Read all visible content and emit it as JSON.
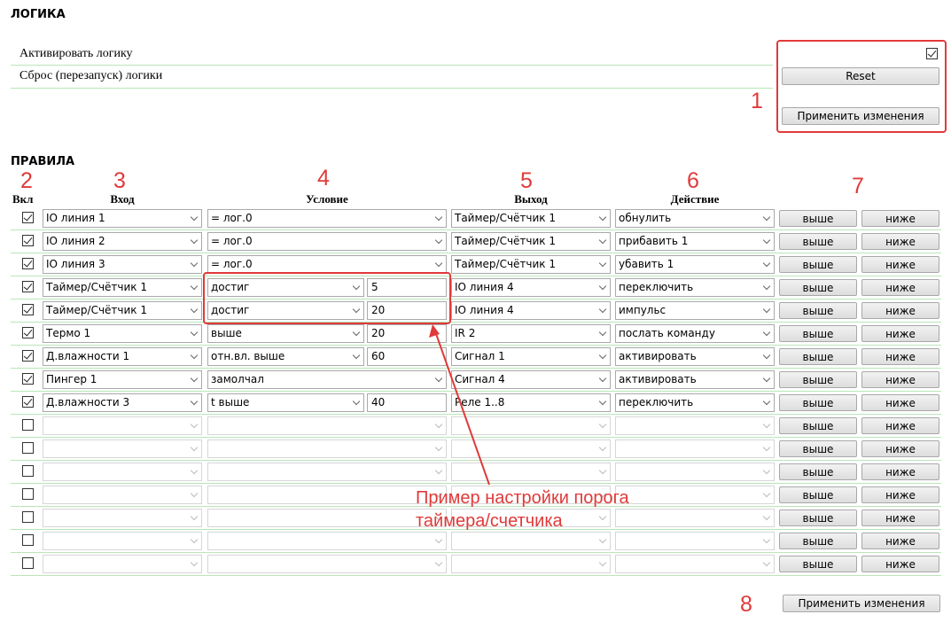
{
  "logic": {
    "title": "ЛОГИКА",
    "activate_label": "Активировать логику",
    "activate_checked": true,
    "reset_label": "Сброс (перезапуск) логики",
    "reset_button": "Reset",
    "apply_button": "Применить изменения"
  },
  "rules": {
    "title": "ПРАВИЛА",
    "headers": {
      "enabled": "Вкл",
      "input": "Вход",
      "condition": "Условие",
      "output": "Выход",
      "action": "Действие"
    },
    "up_label": "выше",
    "down_label": "ниже",
    "apply_button": "Применить изменения",
    "rows": [
      {
        "enabled": true,
        "input": "IO линия 1",
        "condition": "= лог.0",
        "value": null,
        "output": "Таймер/Счётчик 1",
        "action": "обнулить"
      },
      {
        "enabled": true,
        "input": "IO линия 2",
        "condition": "= лог.0",
        "value": null,
        "output": "Таймер/Счётчик 1",
        "action": "прибавить 1"
      },
      {
        "enabled": true,
        "input": "IO линия 3",
        "condition": "= лог.0",
        "value": null,
        "output": "Таймер/Счётчик 1",
        "action": "убавить 1"
      },
      {
        "enabled": true,
        "input": "Таймер/Счётчик 1",
        "condition": "достиг",
        "value": "5",
        "output": "IO линия 4",
        "action": "переключить"
      },
      {
        "enabled": true,
        "input": "Таймер/Счётчик 1",
        "condition": "достиг",
        "value": "20",
        "output": "IO линия 4",
        "action": "импульс"
      },
      {
        "enabled": true,
        "input": "Термо 1",
        "condition": "выше",
        "value": "20",
        "output": "IR 2",
        "action": "послать команду"
      },
      {
        "enabled": true,
        "input": "Д.влажности 1",
        "condition": "отн.вл. выше",
        "value": "60",
        "output": "Сигнал 1",
        "action": "активировать"
      },
      {
        "enabled": true,
        "input": "Пингер 1",
        "condition": "замолчал",
        "value": null,
        "output": "Сигнал 4",
        "action": "активировать"
      },
      {
        "enabled": true,
        "input": "Д.влажности 3",
        "condition": "t выше",
        "value": "40",
        "output": "Реле 1..8",
        "action": "переключить"
      },
      {
        "enabled": false,
        "input": "",
        "condition": "",
        "value": null,
        "output": "",
        "action": ""
      },
      {
        "enabled": false,
        "input": "",
        "condition": "",
        "value": null,
        "output": "",
        "action": ""
      },
      {
        "enabled": false,
        "input": "",
        "condition": "",
        "value": null,
        "output": "",
        "action": ""
      },
      {
        "enabled": false,
        "input": "",
        "condition": "",
        "value": null,
        "output": "",
        "action": ""
      },
      {
        "enabled": false,
        "input": "",
        "condition": "",
        "value": null,
        "output": "",
        "action": ""
      },
      {
        "enabled": false,
        "input": "",
        "condition": "",
        "value": null,
        "output": "",
        "action": ""
      },
      {
        "enabled": false,
        "input": "",
        "condition": "",
        "value": null,
        "output": "",
        "action": ""
      }
    ]
  },
  "annotations": {
    "numbers": [
      "1",
      "2",
      "3",
      "4",
      "5",
      "6",
      "7",
      "8"
    ],
    "callout": [
      "Пример настройки порога",
      "таймера/счетчика"
    ],
    "color": "#e03a3a"
  }
}
